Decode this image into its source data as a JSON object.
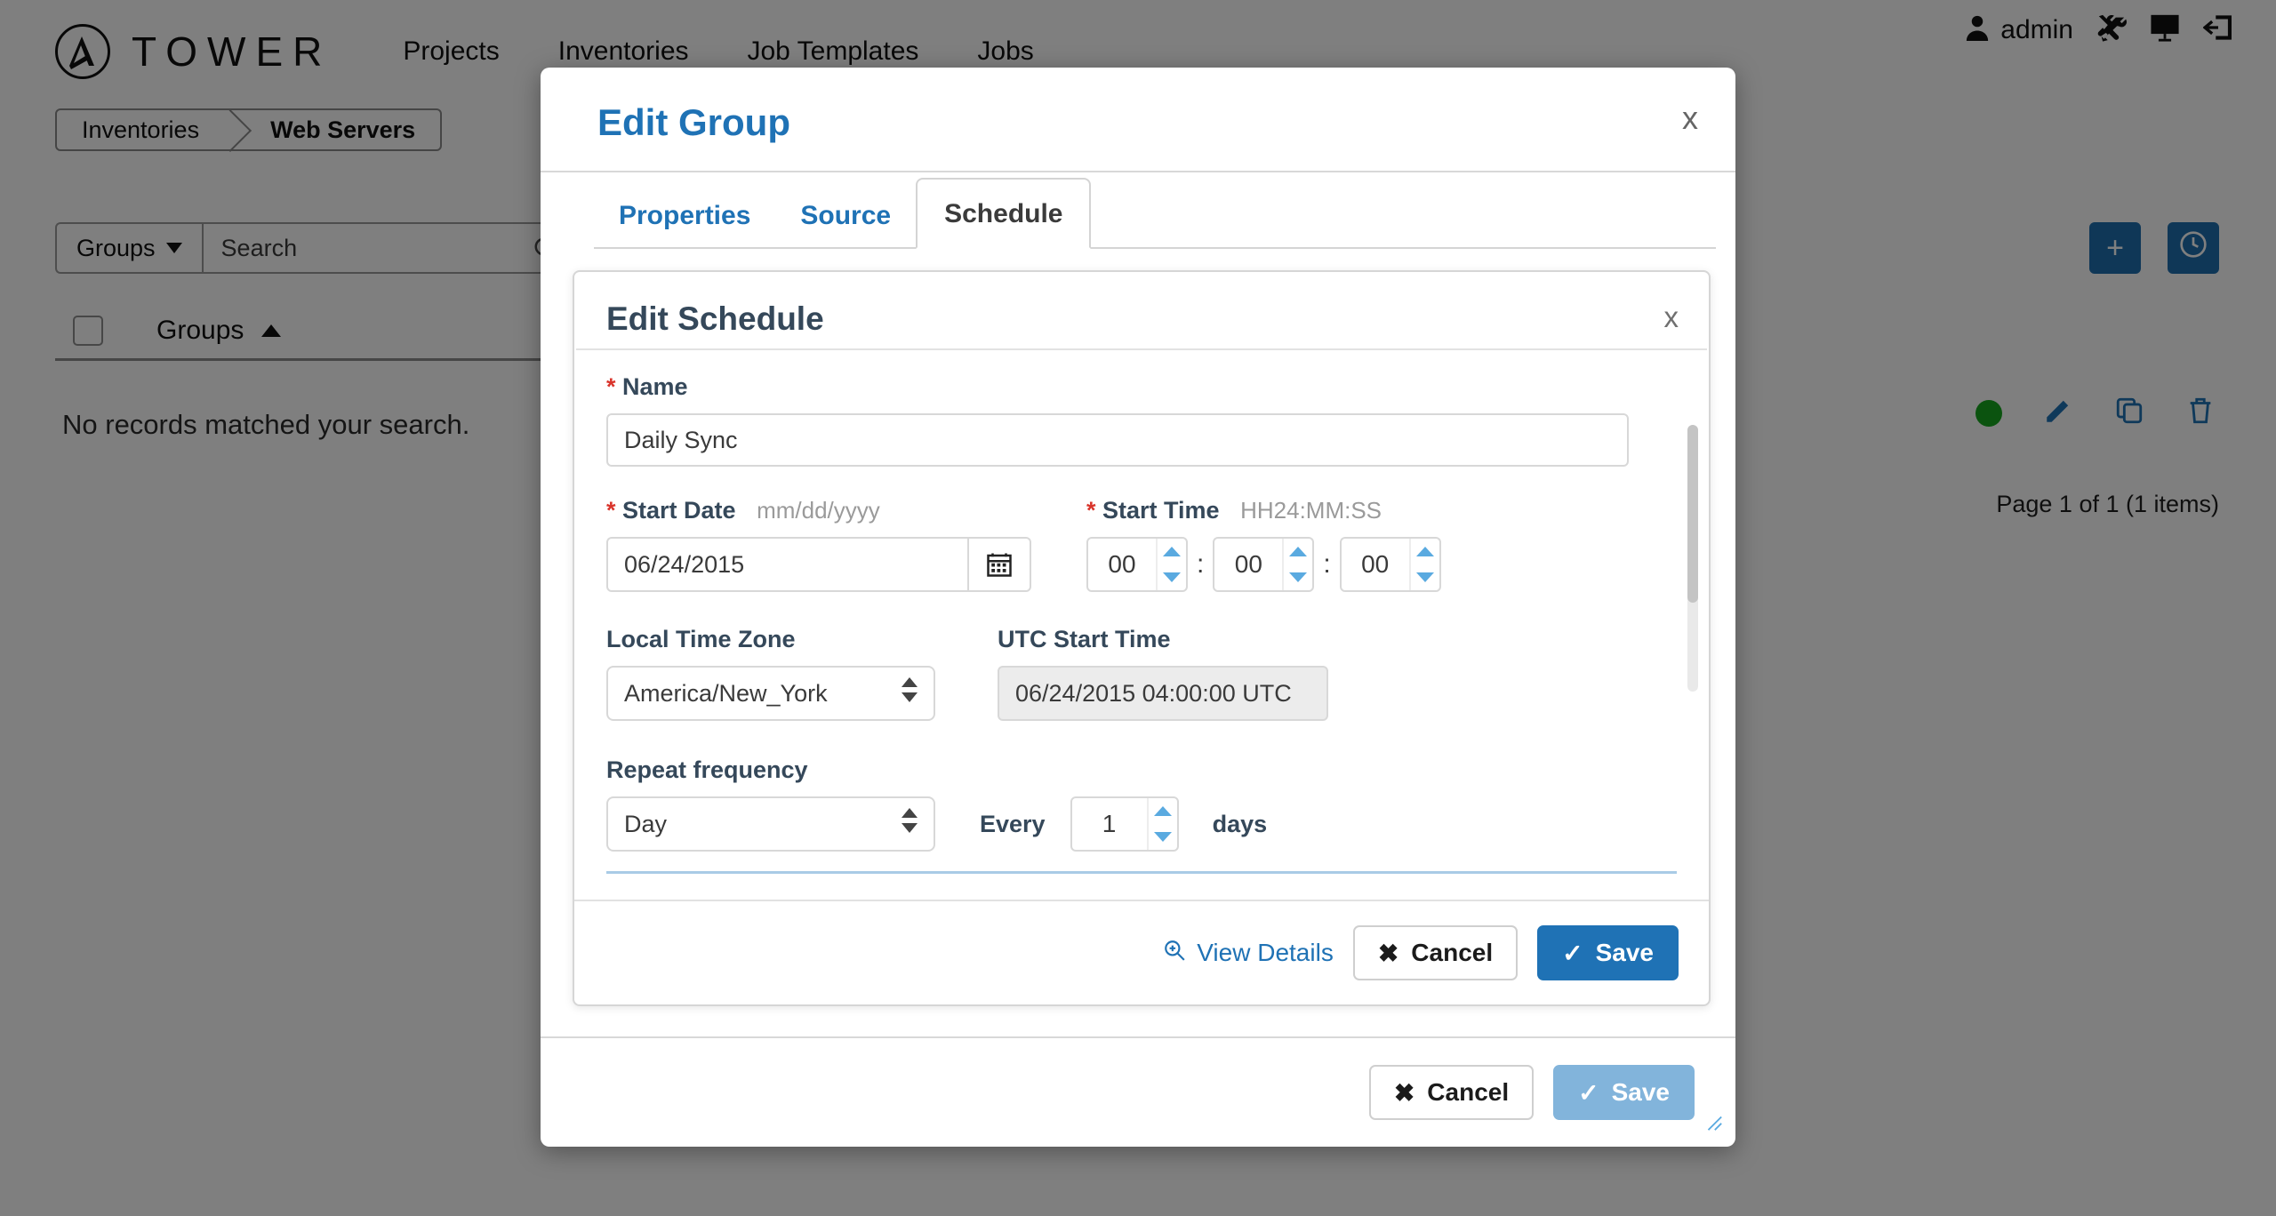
{
  "app": {
    "brand": "TOWER",
    "brand_logo_icon": "ansible-a-logo-icon",
    "nav_links": [
      "Projects",
      "Inventories",
      "Job Templates",
      "Jobs"
    ],
    "user": "admin",
    "user_icon": "user-icon",
    "tools_icon": "wrench-screwdriver-icon",
    "monitor_icon": "monitor-icon",
    "logout_icon": "logout-icon"
  },
  "breadcrumb": {
    "items": [
      "Inventories",
      "Web Servers"
    ]
  },
  "toolbar": {
    "groups_label": "Groups",
    "search_placeholder": "Search",
    "search_value": "",
    "search_icon": "search-icon",
    "add_icon": "plus-icon",
    "history_icon": "clock-icon"
  },
  "table": {
    "column_header": "Groups",
    "sort_icon": "caret-up-icon",
    "empty_message": "No records matched your search.",
    "pager": "Page 1 of 1 (1 items)",
    "row_actions": [
      "status-dot-green",
      "edit-pencil-icon",
      "copy-icon",
      "trash-icon"
    ]
  },
  "modal": {
    "title": "Edit Group",
    "close_label": "x",
    "tabs": [
      {
        "label": "Properties",
        "active": false
      },
      {
        "label": "Source",
        "active": false
      },
      {
        "label": "Schedule",
        "active": true
      }
    ],
    "footer": {
      "cancel_label": "Cancel",
      "save_label": "Save",
      "cancel_icon": "x-icon",
      "save_icon": "check-icon"
    }
  },
  "schedule_panel": {
    "title": "Edit Schedule",
    "close_label": "x",
    "name": {
      "label": "Name",
      "required_marker": "*",
      "value": "Daily Sync",
      "placeholder": ""
    },
    "start_date": {
      "label": "Start Date",
      "required_marker": "*",
      "hint": "mm/dd/yyyy",
      "value": "06/24/2015",
      "calendar_icon": "calendar-icon"
    },
    "start_time": {
      "label": "Start Time",
      "required_marker": "*",
      "hint": "HH24:MM:SS",
      "hours": "00",
      "minutes": "00",
      "seconds": "00",
      "separator": ":"
    },
    "time_zone": {
      "label": "Local Time Zone",
      "value": "America/New_York"
    },
    "utc_start_time": {
      "label": "UTC Start Time",
      "value": "06/24/2015 04:00:00 UTC"
    },
    "repeat": {
      "label": "Repeat frequency",
      "frequency_value": "Day",
      "every_label": "Every",
      "interval_value": "1",
      "unit_label": "days"
    },
    "footer": {
      "view_details_label": "View Details",
      "view_details_icon": "zoom-in-icon",
      "cancel_label": "Cancel",
      "save_label": "Save",
      "cancel_icon": "x-icon",
      "save_icon": "check-icon"
    }
  },
  "colors": {
    "brand_blue": "#1f72b5",
    "label_slate": "#35485a",
    "required_red": "#d9342b",
    "status_green": "#17a61e",
    "spinner_blue": "#5aaae0"
  }
}
